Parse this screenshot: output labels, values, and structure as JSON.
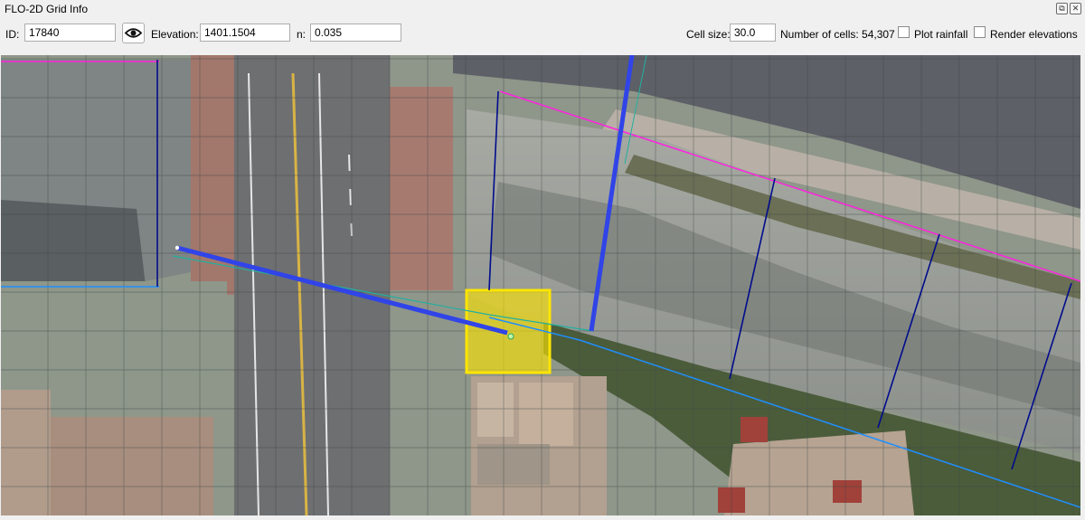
{
  "window": {
    "title": "FLO-2D Grid Info",
    "buttons": [
      "restore-icon",
      "close-icon"
    ]
  },
  "toolbar": {
    "id_label": "ID:",
    "id_value": "17840",
    "view_icon": "eye-icon",
    "elevation_label": "Elevation:",
    "elevation_value": "1401.1504",
    "n_label": "n:",
    "n_value": "0.035",
    "cell_size_label": "Cell size:",
    "cell_size_value": "30.0",
    "num_cells_label": "Number of cells: 54,307",
    "plot_rainfall_label": "Plot rainfall",
    "plot_rainfall_checked": false,
    "render_elevations_label": "Render elevations",
    "render_elevations_checked": false
  },
  "map": {
    "selected_cell_color": "#ffe500",
    "channel_line_color": "#3044e8",
    "cross_section_color": "#000c8c",
    "left_bank_color": "#ff22e0",
    "right_bank_color": "#1e8fff",
    "centerline_color": "#20b0a0"
  }
}
